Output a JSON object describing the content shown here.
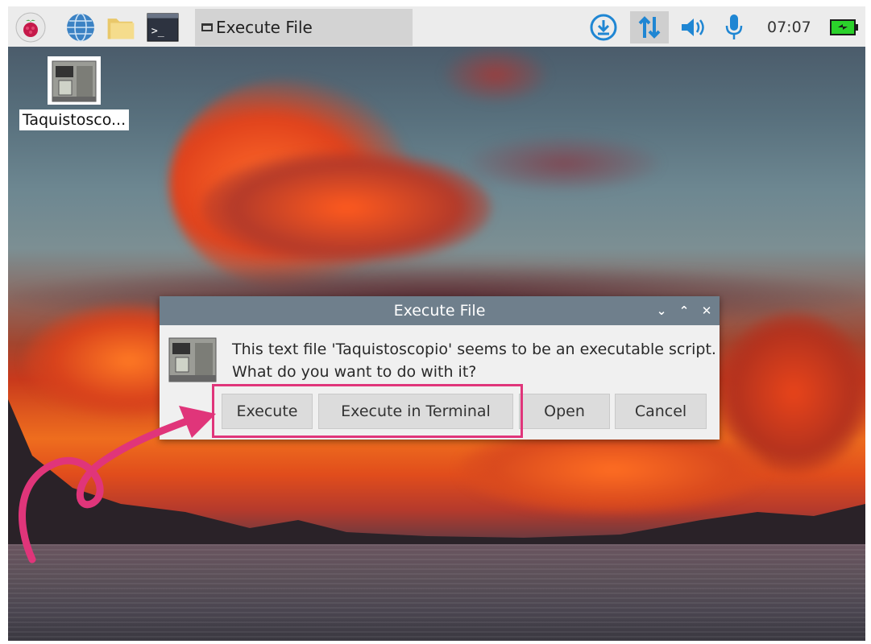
{
  "taskbar": {
    "launcher_icons": [
      "raspberry-menu-icon",
      "web-browser-icon",
      "file-manager-icon",
      "terminal-icon"
    ],
    "window_button_label": "Execute File",
    "tray_icons": [
      "download-icon",
      "network-arrows-icon",
      "volume-icon",
      "microphone-icon",
      "battery-icon"
    ],
    "clock": "07:07"
  },
  "desktop": {
    "icon_label": "Taquistosco..."
  },
  "dialog": {
    "title": "Execute File",
    "message_line1": "This text file 'Taquistoscopio' seems to be an executable script.",
    "message_line2": "What do you want to do with it?",
    "buttons": {
      "execute": "Execute",
      "execute_in_terminal": "Execute in Terminal",
      "open": "Open",
      "cancel": "Cancel"
    }
  },
  "colors": {
    "highlight": "#e0357a",
    "titlebar": "#6f7f8c",
    "taskbar": "#ececec"
  }
}
